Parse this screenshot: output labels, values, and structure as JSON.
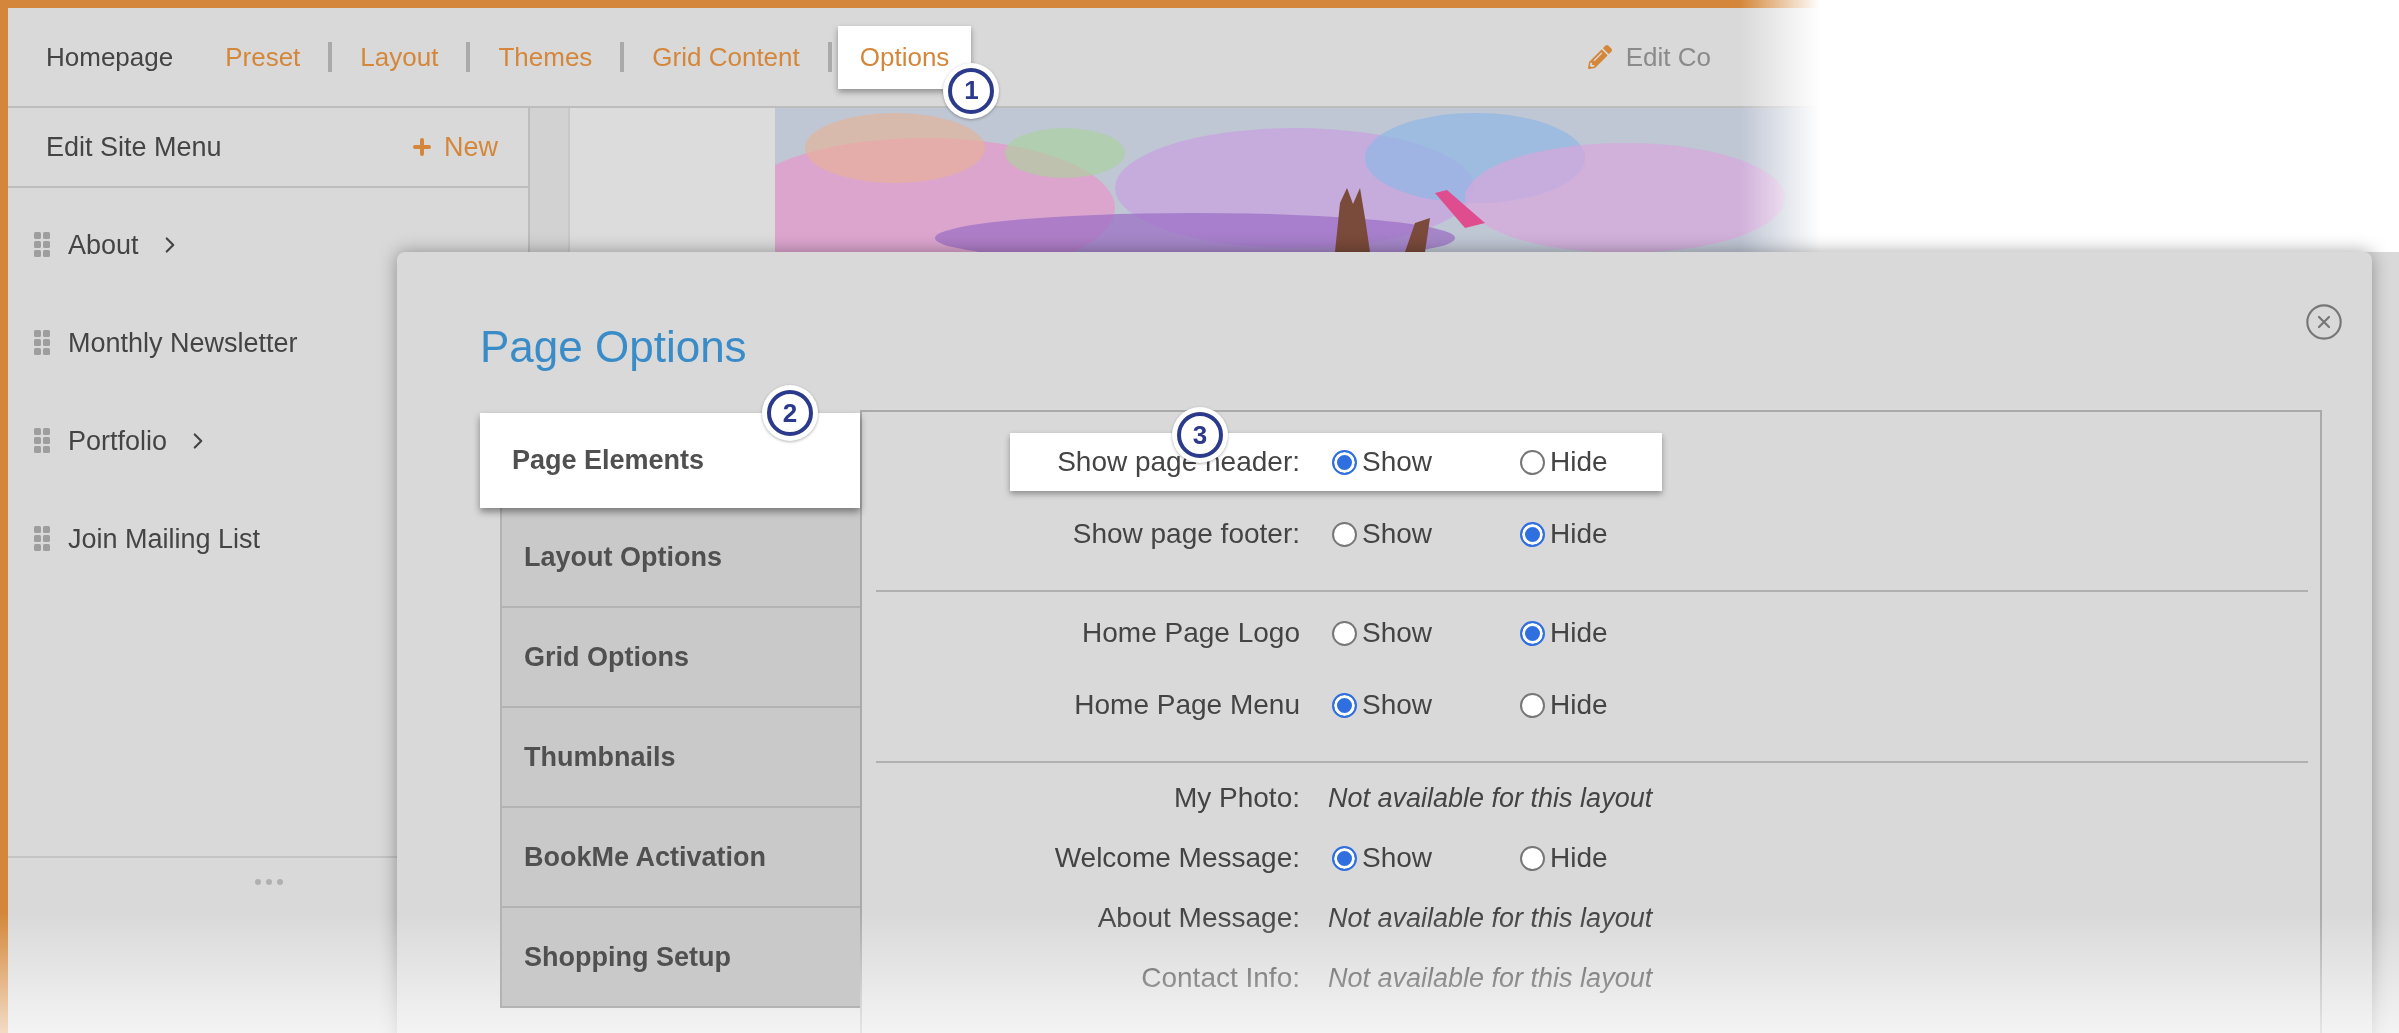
{
  "top_nav": {
    "breadcrumb": "Homepage",
    "tabs": [
      {
        "label": "Preset",
        "selected": false
      },
      {
        "label": "Layout",
        "selected": false
      },
      {
        "label": "Themes",
        "selected": false
      },
      {
        "label": "Grid Content",
        "selected": false
      },
      {
        "label": "Options",
        "selected": true,
        "callout": "1"
      }
    ],
    "edit_button": "Edit Co"
  },
  "site_menu": {
    "title": "Edit Site Menu",
    "new_button": "New",
    "items": [
      {
        "label": "About",
        "has_submenu": true
      },
      {
        "label": "Monthly Newsletter",
        "has_submenu": false
      },
      {
        "label": "Portfolio",
        "has_submenu": true
      },
      {
        "label": "Join Mailing List",
        "has_submenu": false
      }
    ]
  },
  "dialog": {
    "title": "Page Options",
    "tabs": [
      {
        "label": "Page Elements",
        "selected": true,
        "callout": "2"
      },
      {
        "label": "Layout Options",
        "selected": false
      },
      {
        "label": "Grid Options",
        "selected": false
      },
      {
        "label": "Thumbnails",
        "selected": false
      },
      {
        "label": "BookMe Activation",
        "selected": false
      },
      {
        "label": "Shopping Setup",
        "selected": false
      }
    ],
    "sections": [
      {
        "rows": [
          {
            "kind": "radio",
            "label": "Show page header:",
            "callout": "3",
            "options": [
              {
                "label": "Show",
                "selected": true
              },
              {
                "label": "Hide",
                "selected": false
              }
            ]
          },
          {
            "kind": "radio",
            "label": "Show page footer:",
            "options": [
              {
                "label": "Show",
                "selected": false
              },
              {
                "label": "Hide",
                "selected": true
              }
            ]
          }
        ]
      },
      {
        "rows": [
          {
            "kind": "radio",
            "label": "Home Page Logo",
            "options": [
              {
                "label": "Show",
                "selected": false
              },
              {
                "label": "Hide",
                "selected": true
              }
            ]
          },
          {
            "kind": "radio",
            "label": "Home Page Menu",
            "options": [
              {
                "label": "Show",
                "selected": true
              },
              {
                "label": "Hide",
                "selected": false
              }
            ]
          }
        ]
      },
      {
        "rows": [
          {
            "kind": "note",
            "label": "My Photo:",
            "note": "Not available for this layout"
          },
          {
            "kind": "radio",
            "label": "Welcome Message:",
            "options": [
              {
                "label": "Show",
                "selected": true
              },
              {
                "label": "Hide",
                "selected": false
              }
            ]
          },
          {
            "kind": "note",
            "label": "About Message:",
            "note": "Not available for this layout"
          },
          {
            "kind": "note",
            "label": "Contact Info:",
            "note": "Not available for this layout"
          }
        ]
      }
    ]
  }
}
